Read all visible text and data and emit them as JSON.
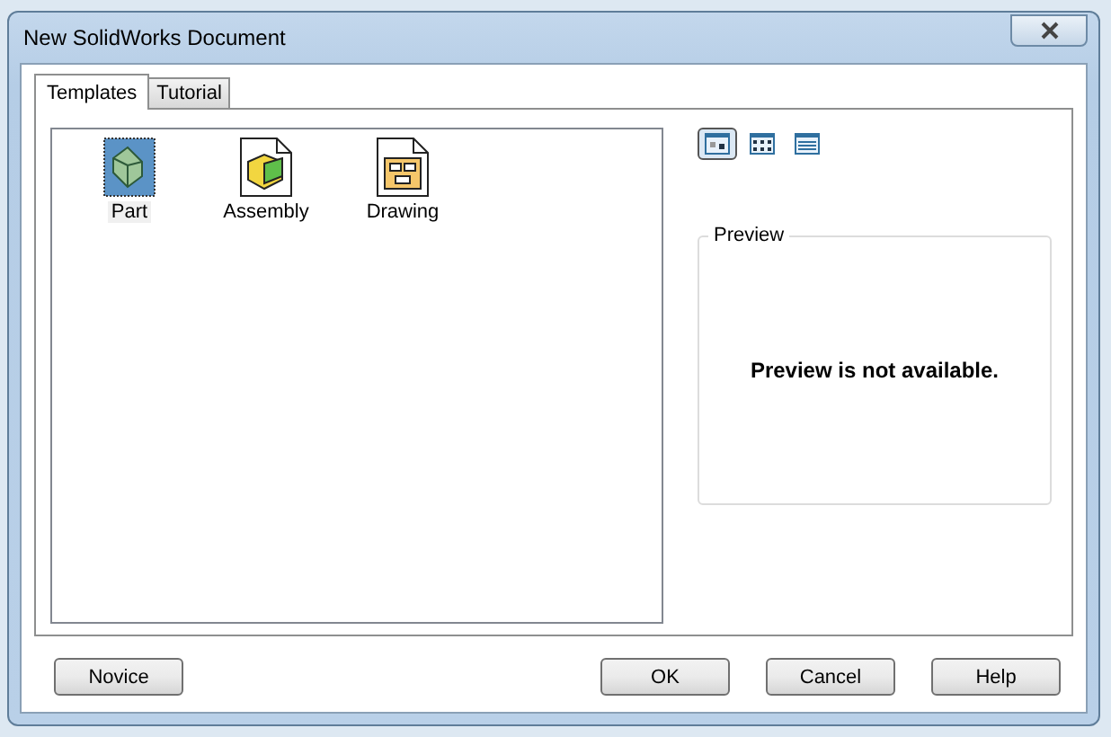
{
  "window": {
    "title": "New SolidWorks Document"
  },
  "tabs": [
    {
      "label": "Templates",
      "selected": true
    },
    {
      "label": "Tutorial",
      "selected": false
    }
  ],
  "templates": [
    {
      "label": "Part",
      "kind": "part",
      "selected": true
    },
    {
      "label": "Assembly",
      "kind": "assembly",
      "selected": false
    },
    {
      "label": "Drawing",
      "kind": "drawing",
      "selected": false
    }
  ],
  "view_buttons": [
    {
      "kind": "large",
      "selected": true
    },
    {
      "kind": "list",
      "selected": false
    },
    {
      "kind": "details",
      "selected": false
    }
  ],
  "preview": {
    "title": "Preview",
    "message": "Preview is not available."
  },
  "buttons": {
    "left": [
      "Novice"
    ],
    "right": [
      "OK",
      "Cancel",
      "Help"
    ]
  }
}
